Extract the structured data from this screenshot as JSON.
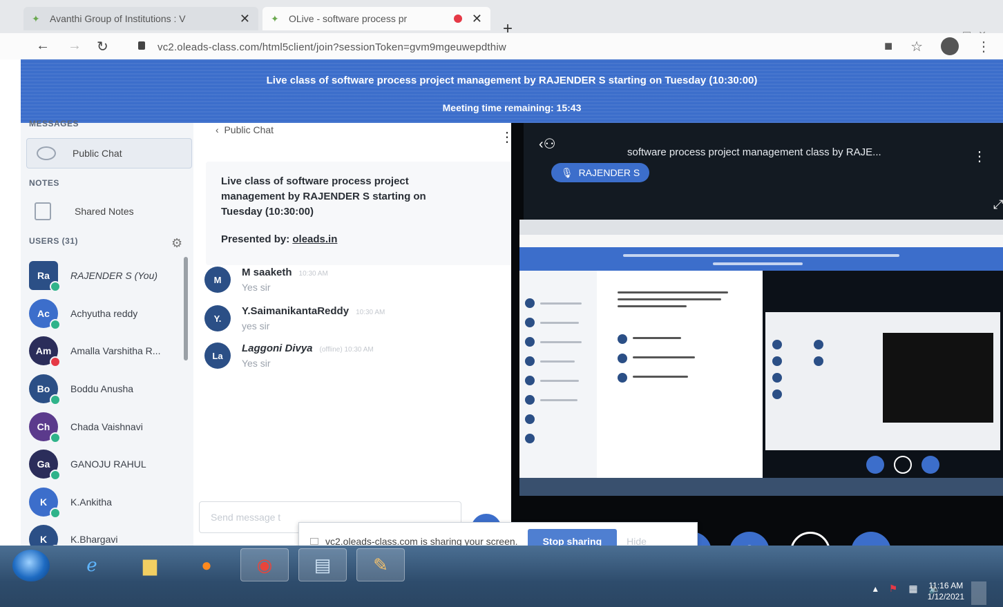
{
  "browser": {
    "tabs": [
      {
        "label": "Avanthi Group of Institutions : V",
        "active": false
      },
      {
        "label": "OLive - software process pr",
        "active": true
      }
    ],
    "url": "vc2.oleads-class.com/html5client/join?sessionToken=gvm9mgeuwepdthiw"
  },
  "banner": {
    "line1": "Live class of software process project management by RAJENDER S starting on Tuesday (10:30:00)",
    "line2": "Meeting time remaining: 15:43"
  },
  "sidebar": {
    "messages_title": "MESSAGES",
    "public_chat": "Public Chat",
    "notes_title": "NOTES",
    "shared_notes": "Shared Notes",
    "users_title": "USERS (31)",
    "users": [
      {
        "initials": "Ra",
        "name": "RAJENDER S (You)",
        "color": "#2b4f86"
      },
      {
        "initials": "Ac",
        "name": "Achyutha reddy",
        "color": "#3c6ecb"
      },
      {
        "initials": "Am",
        "name": "Amalla Varshitha R...",
        "color": "#2b2d5a"
      },
      {
        "initials": "Bo",
        "name": "Boddu Anusha",
        "color": "#2b4f86"
      },
      {
        "initials": "Ch",
        "name": "Chada Vaishnavi",
        "color": "#5b3a8c"
      },
      {
        "initials": "Ga",
        "name": "GANOJU RAHUL",
        "color": "#2b2d5a"
      },
      {
        "initials": "K",
        "name": "K.Ankitha",
        "color": "#3c6ecb"
      },
      {
        "initials": "K",
        "name": "K.Bhargavi",
        "color": "#2b4f86"
      }
    ]
  },
  "chat": {
    "back_label": "Public Chat",
    "welcome_title": "Live class of software process project management by RAJENDER S starting on Tuesday (10:30:00)",
    "presented_by_label": "Presented by:",
    "presented_by_link": "oleads.in",
    "messages": [
      {
        "initials": "M",
        "sender": "M saaketh",
        "meta": "10:30 AM",
        "text": "Yes sir"
      },
      {
        "initials": "Y.",
        "sender": "Y.SaimanikantaReddy",
        "meta": "10:30 AM",
        "text": "yes sir"
      },
      {
        "initials": "La",
        "sender": "Laggoni Divya",
        "meta": "(offline)   10:30 AM",
        "text": "Yes sir"
      }
    ],
    "input_placeholder": "Send message t"
  },
  "stage": {
    "title": "software process project management class by RAJE...",
    "presenter": "RAJENDER S"
  },
  "share_notice": {
    "text": "vc2.oleads-class.com is sharing your screen.",
    "stop_label": "Stop sharing",
    "hide_label": "Hide"
  },
  "taskbar": {
    "time": "11:16 AM",
    "date": "1/12/2021"
  }
}
